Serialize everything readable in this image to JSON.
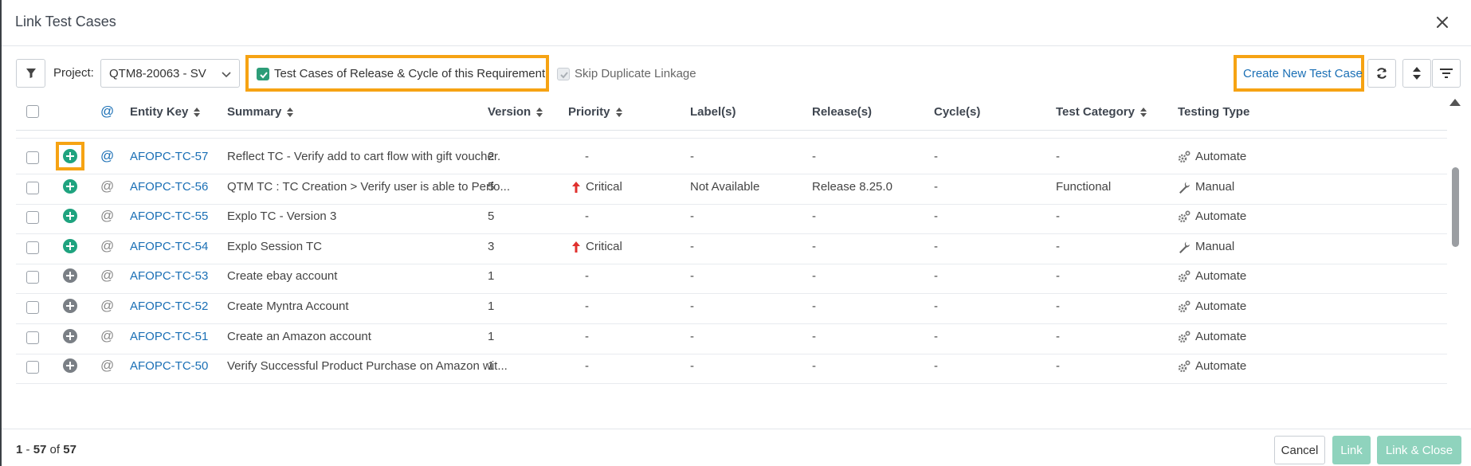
{
  "dialog": {
    "title": "Link Test Cases"
  },
  "toolbar": {
    "project_label": "Project:",
    "project_value": "QTM8-20063 - SV",
    "release_filter_label": "Test Cases of Release & Cycle of this Requirement",
    "release_filter_checked": true,
    "skip_duplicate_label": "Skip Duplicate Linkage",
    "skip_duplicate_checked": true,
    "skip_duplicate_disabled": true,
    "create_new_label": "Create New Test Case"
  },
  "table": {
    "columns": {
      "at": "@",
      "entity_key": "Entity Key",
      "summary": "Summary",
      "version": "Version",
      "priority": "Priority",
      "labels": "Label(s)",
      "releases": "Release(s)",
      "cycles": "Cycle(s)",
      "test_category": "Test Category",
      "testing_type": "Testing Type"
    },
    "rows": [
      {
        "key": "AFOPC-TC-57",
        "summary": "Reflect TC - Verify add to cart flow with gift voucher.",
        "version": "2",
        "priority": "-",
        "labels": "-",
        "releases": "-",
        "cycles": "-",
        "category": "-",
        "type": "Automate",
        "link_state": "available"
      },
      {
        "key": "AFOPC-TC-56",
        "summary": "QTM TC : TC Creation > Verify user is able to Perfo...",
        "version": "5",
        "priority": "Critical",
        "labels": "Not Available",
        "releases": "Release 8.25.0",
        "cycles": "-",
        "category": "Functional",
        "type": "Manual",
        "link_state": "available"
      },
      {
        "key": "AFOPC-TC-55",
        "summary": "Explo TC - Version 3",
        "version": "5",
        "priority": "-",
        "labels": "-",
        "releases": "-",
        "cycles": "-",
        "category": "-",
        "type": "Automate",
        "link_state": "available"
      },
      {
        "key": "AFOPC-TC-54",
        "summary": "Explo Session TC",
        "version": "3",
        "priority": "Critical",
        "labels": "-",
        "releases": "-",
        "cycles": "-",
        "category": "-",
        "type": "Manual",
        "link_state": "available"
      },
      {
        "key": "AFOPC-TC-53",
        "summary": "Create ebay account",
        "version": "1",
        "priority": "-",
        "labels": "-",
        "releases": "-",
        "cycles": "-",
        "category": "-",
        "type": "Automate",
        "link_state": "unavailable"
      },
      {
        "key": "AFOPC-TC-52",
        "summary": "Create Myntra Account",
        "version": "1",
        "priority": "-",
        "labels": "-",
        "releases": "-",
        "cycles": "-",
        "category": "-",
        "type": "Automate",
        "link_state": "unavailable"
      },
      {
        "key": "AFOPC-TC-51",
        "summary": "Create an Amazon account",
        "version": "1",
        "priority": "-",
        "labels": "-",
        "releases": "-",
        "cycles": "-",
        "category": "-",
        "type": "Automate",
        "link_state": "unavailable"
      },
      {
        "key": "AFOPC-TC-50",
        "summary": "Verify Successful Product Purchase on Amazon wit...",
        "version": "1",
        "priority": "-",
        "labels": "-",
        "releases": "-",
        "cycles": "-",
        "category": "-",
        "type": "Automate",
        "link_state": "unavailable"
      }
    ]
  },
  "footer": {
    "range_start": "1",
    "range_sep": " - ",
    "range_end": "57",
    "of_label": " of ",
    "total": "57",
    "cancel_label": "Cancel",
    "link_label": "Link",
    "link_close_label": "Link & Close"
  },
  "colors": {
    "accent_link": "#1a6fb5",
    "highlight": "#f6a313",
    "primary_green": "#1fa37f",
    "disabled_green": "#8fd3bd",
    "priority_critical": "#e0312e"
  },
  "icons": {
    "close": "close-icon",
    "filter": "funnel-icon",
    "refresh": "refresh-icon",
    "sort": "sort-icon",
    "column_filter": "column-filter-icon",
    "link_add": "plus-circle-icon",
    "automated": "gears-icon",
    "manual": "wrench-icon",
    "critical": "arrow-up-icon"
  }
}
